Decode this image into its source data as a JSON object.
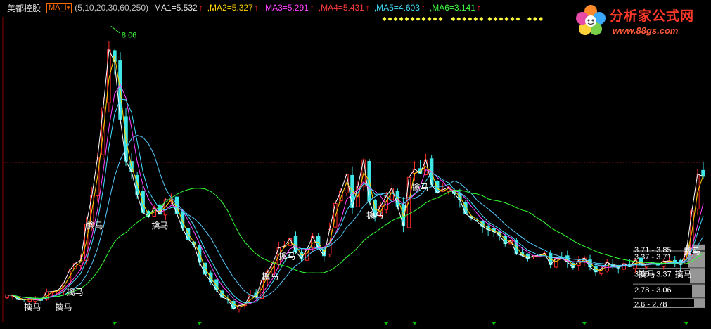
{
  "header": {
    "stock_name": "美都控股",
    "formula_name": "MA_I",
    "params": "(5,10,20,30,60,250)",
    "indicators": [
      {
        "label": "MA1=5.532",
        "color": "#e8e8e8"
      },
      {
        "label": ",MA2=5.327",
        "color": "#ffd200"
      },
      {
        "label": ",MA3=5.291",
        "color": "#ff44ff"
      },
      {
        "label": ",MA4=5.431",
        "color": "#ff3c3c"
      },
      {
        "label": ",MA5=4.603",
        "color": "#40e0ff"
      },
      {
        "label": ",MA6=3.141",
        "color": "#40ff40"
      }
    ],
    "arrow": "↑"
  },
  "logo": {
    "name": "分析家公式网",
    "url": "www.88gs.com"
  },
  "chart_data": {
    "type": "candlestick",
    "peak_label": "8.06",
    "y_range": [
      2.4,
      8.3
    ],
    "reference_price": 5.45,
    "close_path": [
      [
        0,
        2.85
      ],
      [
        5,
        2.75
      ],
      [
        9,
        2.95
      ],
      [
        13,
        3.6
      ],
      [
        16,
        5.5
      ],
      [
        17.5,
        7.2
      ],
      [
        18.5,
        8.06
      ],
      [
        19.5,
        6.8
      ],
      [
        21,
        5.6
      ],
      [
        23,
        4.7
      ],
      [
        25,
        4.4
      ],
      [
        27,
        4.5
      ],
      [
        28.5,
        4.85
      ],
      [
        30,
        4.4
      ],
      [
        32,
        4.0
      ],
      [
        34,
        3.5
      ],
      [
        36,
        3.1
      ],
      [
        38,
        2.85
      ],
      [
        40,
        2.6
      ],
      [
        42,
        2.72
      ],
      [
        44,
        2.85
      ],
      [
        46,
        3.3
      ],
      [
        48,
        3.75
      ],
      [
        50,
        3.9
      ],
      [
        51.5,
        3.55
      ],
      [
        53,
        3.8
      ],
      [
        54,
        4.0
      ],
      [
        56,
        3.7
      ],
      [
        58,
        4.6
      ],
      [
        60,
        5.1
      ],
      [
        61,
        4.6
      ],
      [
        62,
        5.0
      ],
      [
        63,
        5.5
      ],
      [
        64,
        4.7
      ],
      [
        65,
        4.3
      ],
      [
        66,
        4.6
      ],
      [
        68,
        5.0
      ],
      [
        69,
        4.65
      ],
      [
        69.8,
        3.9
      ],
      [
        70.5,
        4.8
      ],
      [
        71.5,
        5.7
      ],
      [
        72.5,
        5.05
      ],
      [
        74,
        5.4
      ],
      [
        75,
        4.9
      ],
      [
        76,
        4.75
      ],
      [
        78,
        4.9
      ],
      [
        80,
        4.7
      ],
      [
        82,
        4.4
      ],
      [
        84,
        4.25
      ],
      [
        86,
        4.05
      ],
      [
        88,
        3.9
      ],
      [
        90,
        3.75
      ],
      [
        92,
        3.55
      ],
      [
        94,
        3.7
      ],
      [
        96,
        3.45
      ],
      [
        98,
        3.55
      ],
      [
        100,
        3.45
      ],
      [
        102,
        3.5
      ],
      [
        104,
        3.38
      ],
      [
        106,
        3.45
      ],
      [
        108,
        3.35
      ],
      [
        110,
        3.45
      ],
      [
        112,
        3.5
      ],
      [
        114,
        3.55
      ],
      [
        116,
        3.5
      ],
      [
        118,
        3.42
      ],
      [
        119.5,
        3.55
      ],
      [
        120.5,
        3.8
      ],
      [
        121,
        4.6
      ],
      [
        121.5,
        5.5
      ],
      [
        122.5,
        5.05
      ],
      [
        123.5,
        5.3
      ]
    ],
    "x_count": 124,
    "annotations": [
      {
        "text": "擒马",
        "x": 4.5,
        "price": 2.55
      },
      {
        "text": "擒马",
        "x": 10,
        "price": 2.55
      },
      {
        "text": "擒马",
        "x": 12,
        "price": 2.85
      },
      {
        "text": "擒马",
        "x": 15.5,
        "price": 4.15
      },
      {
        "text": "擒马",
        "x": 27,
        "price": 4.15
      },
      {
        "text": "擒马",
        "x": 49.5,
        "price": 3.55
      },
      {
        "text": "擒马",
        "x": 46.5,
        "price": 3.15
      },
      {
        "text": "擒马",
        "x": 65,
        "price": 4.35
      },
      {
        "text": "擒马",
        "x": 73,
        "price": 4.9
      },
      {
        "text": "擒马",
        "x": 113,
        "price": 3.2
      },
      {
        "text": "擒马",
        "x": 119.5,
        "price": 3.2
      },
      {
        "text": "擒马",
        "x": 121,
        "price": 3.65
      }
    ],
    "price_bands": [
      {
        "label": "3.71 - 3.85",
        "low": 3.71,
        "high": 3.85
      },
      {
        "label": "3.37 - 3.71",
        "low": 3.37,
        "high": 3.71
      },
      {
        "label": "3.06 - 3.37",
        "low": 3.06,
        "high": 3.37
      },
      {
        "label": "2.78 - 3.06",
        "low": 2.78,
        "high": 3.06
      },
      {
        "label": "2.6 - 2.78",
        "low": 2.6,
        "high": 2.78
      }
    ],
    "signal_arrows_x": [
      19,
      34,
      67,
      72,
      86,
      102,
      120
    ],
    "colors": {
      "up": "#ff2a2a",
      "down": "#3ee8e8",
      "ma5": "#ffffff",
      "ma10": "#ffd200",
      "ma20": "#ff44ff",
      "ma30": "#40e0ff",
      "ma60": "#55ccff",
      "ma250": "#30ff30",
      "ref_line": "#ff2020",
      "band": "#c8c8c8",
      "signal": "#00c000",
      "peak": "#40ff40",
      "marker": "#ffff40"
    }
  }
}
